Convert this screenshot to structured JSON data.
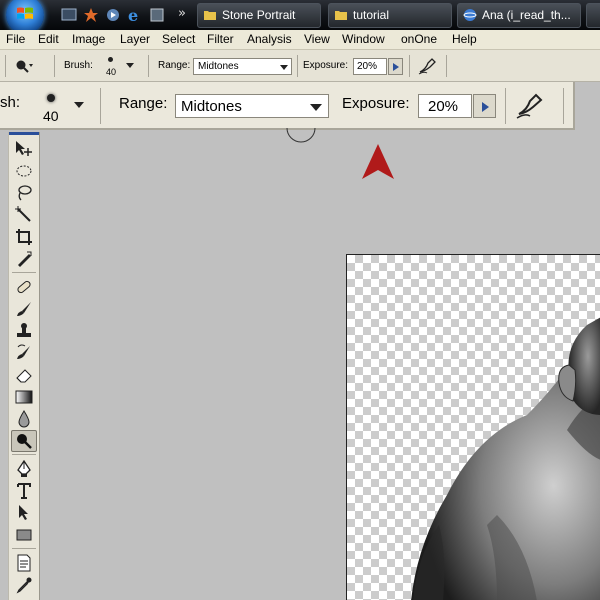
{
  "taskbar": {
    "quicklaunch_more": "»",
    "tasks": [
      {
        "label": "Stone Portrait"
      },
      {
        "label": "tutorial"
      },
      {
        "label": "Ana (i_read_th..."
      }
    ]
  },
  "menubar": {
    "items": [
      "File",
      "Edit",
      "Image",
      "Layer",
      "Select",
      "Filter",
      "Analysis",
      "View",
      "Window",
      "onOne",
      "Help"
    ]
  },
  "options_bar": {
    "brush_label": "Brush:",
    "brush_size": "40",
    "range_label": "Range:",
    "range_value": "Midtones",
    "exposure_label": "Exposure:",
    "exposure_value": "20%"
  },
  "zoomed_options_bar": {
    "brush_label_fragment": "sh:",
    "brush_size": "40",
    "range_label": "Range:",
    "range_value": "Midtones",
    "exposure_label": "Exposure:",
    "exposure_value": "20%"
  },
  "colors": {
    "arrow": "#b01a1a",
    "workspace": "#c0c0c0",
    "panel": "#ebe8dc"
  }
}
